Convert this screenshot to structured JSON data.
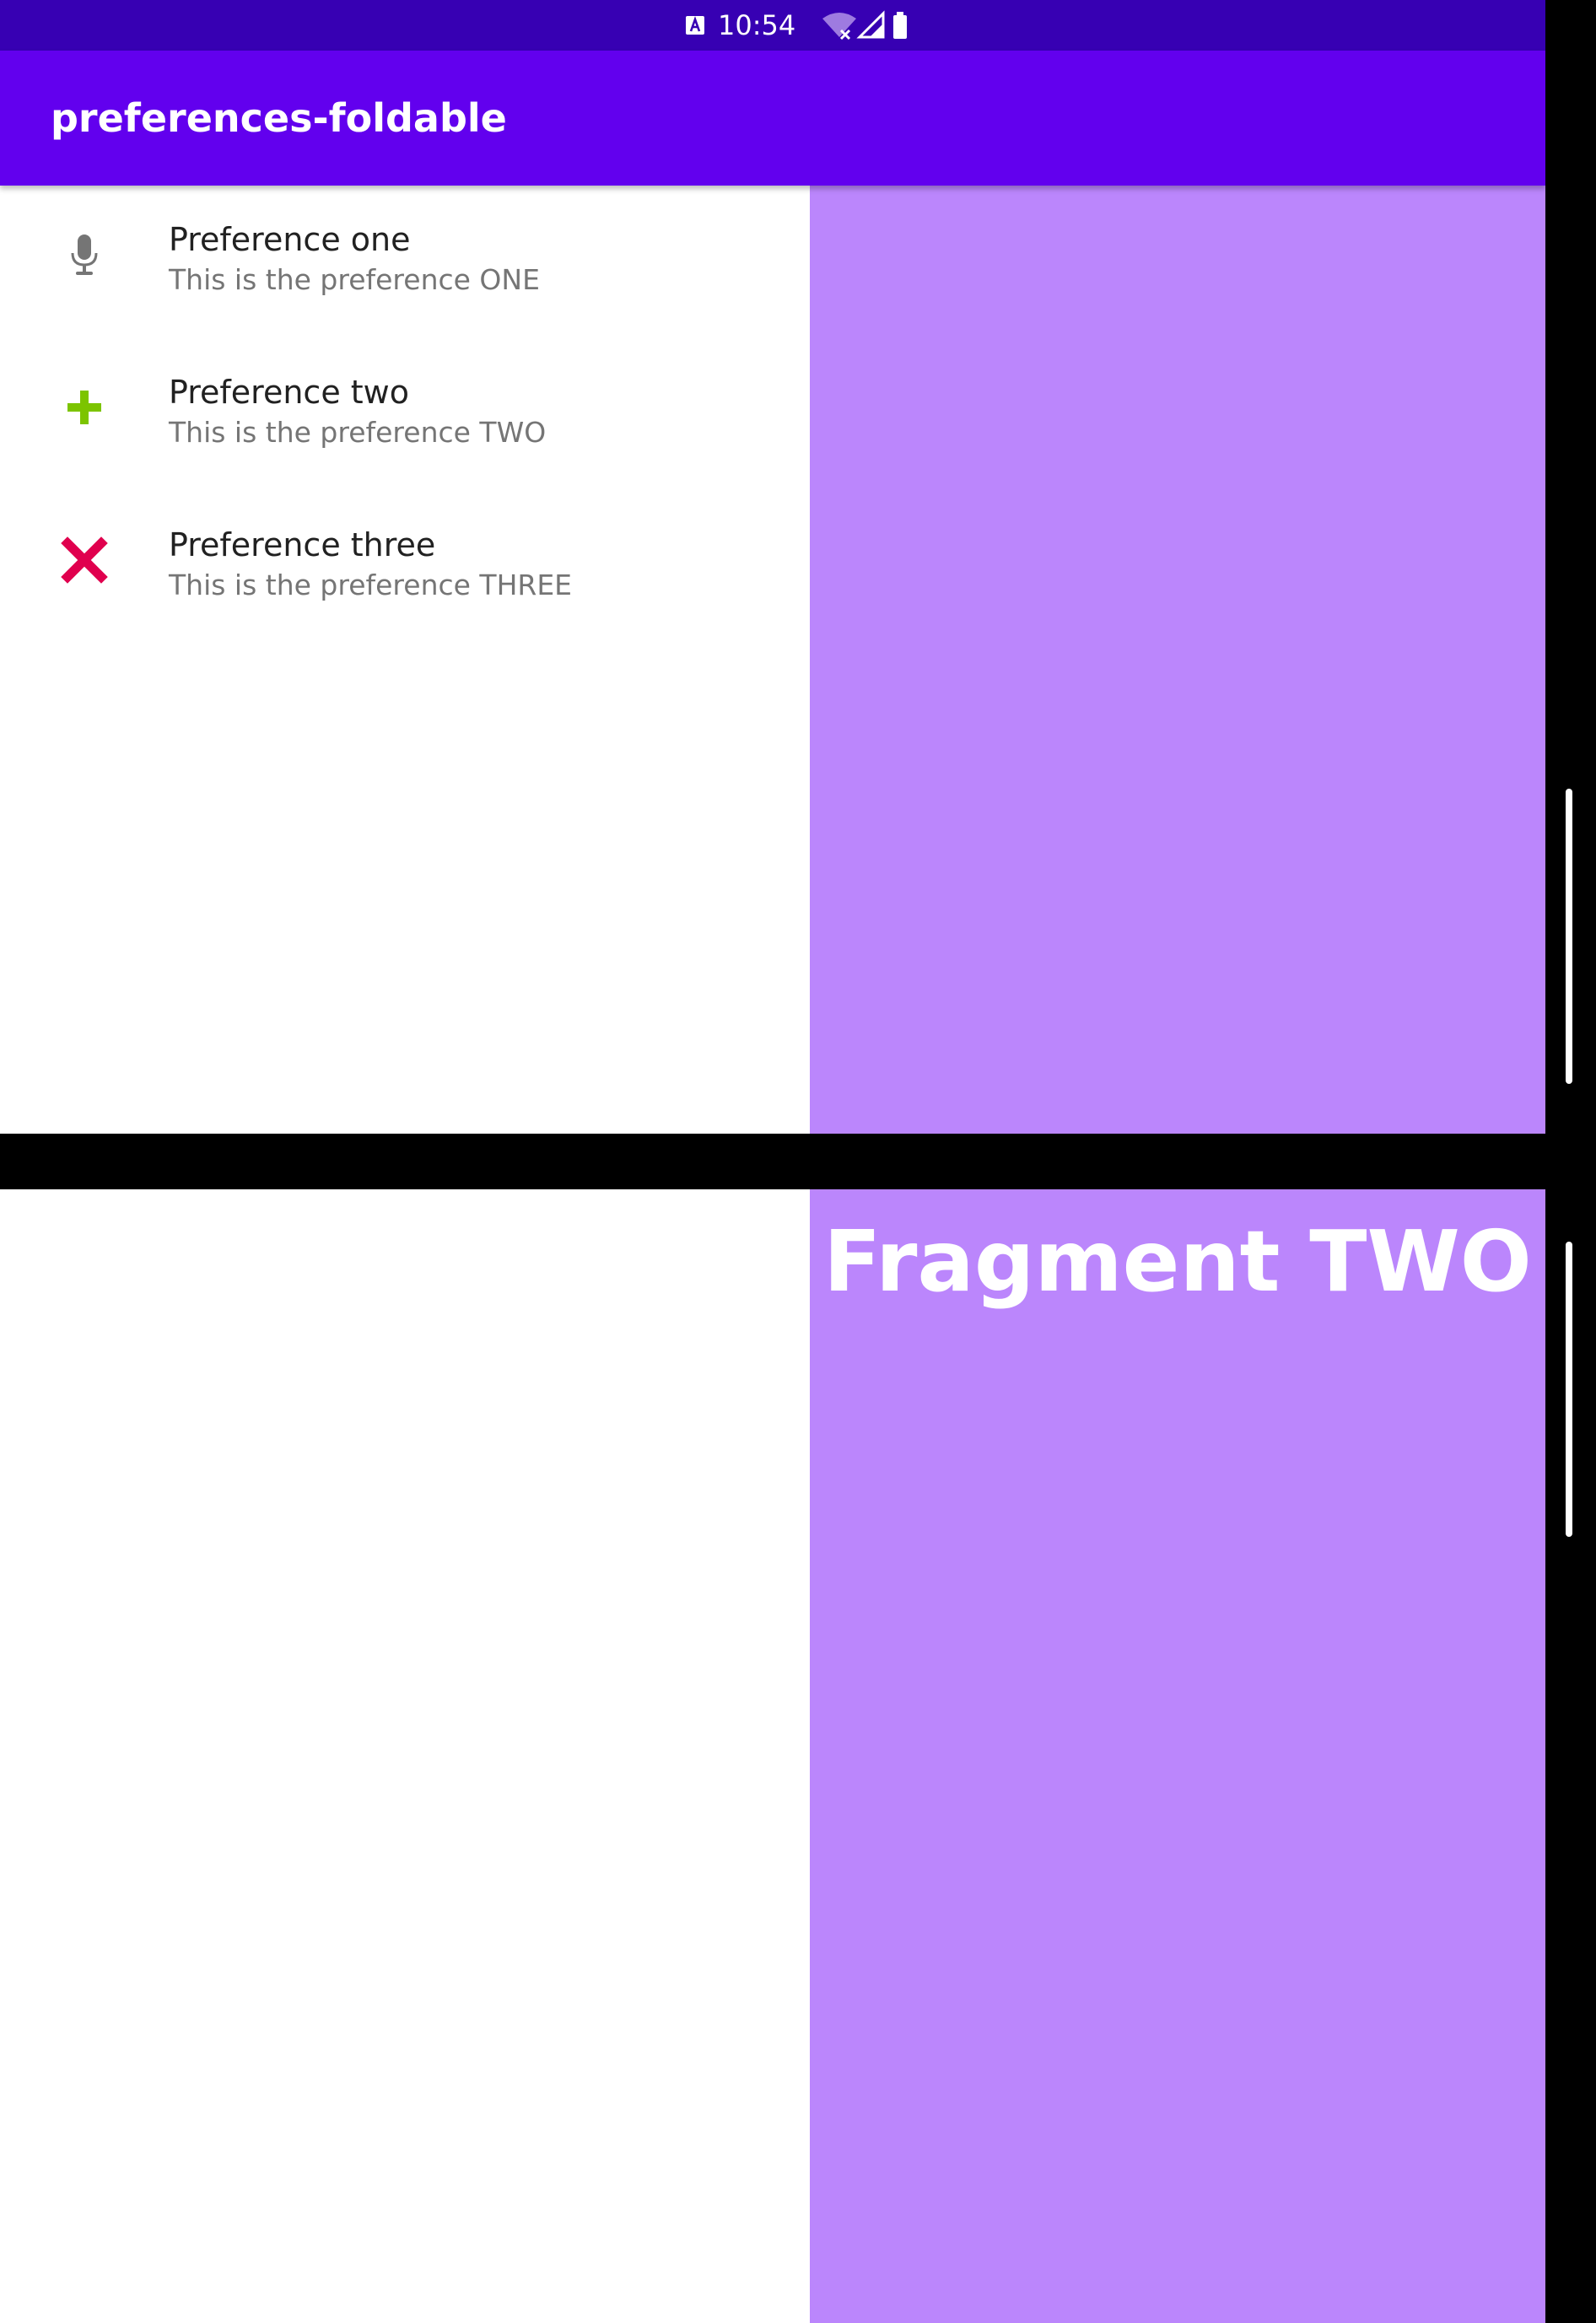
{
  "status_bar": {
    "time": "10:54",
    "icons": [
      "app-notification-icon",
      "wifi-off-icon",
      "cellular-signal-icon",
      "battery-icon"
    ]
  },
  "app_bar": {
    "title": "preferences-foldable"
  },
  "preferences": [
    {
      "title": "Preference one",
      "summary": "This is the preference ONE",
      "icon": "microphone-icon",
      "icon_color": "#757575"
    },
    {
      "title": "Preference two",
      "summary": "This is the preference TWO",
      "icon": "plus-icon",
      "icon_color": "#7cc400"
    },
    {
      "title": "Preference three",
      "summary": "This is the preference THREE",
      "icon": "close-x-icon",
      "icon_color": "#e0004e"
    }
  ],
  "detail": {
    "title": "Fragment TWO"
  },
  "colors": {
    "status_bar": "#3700b3",
    "primary": "#6200ee",
    "detail_background": "#bb86fc",
    "hinge": "#000000"
  }
}
